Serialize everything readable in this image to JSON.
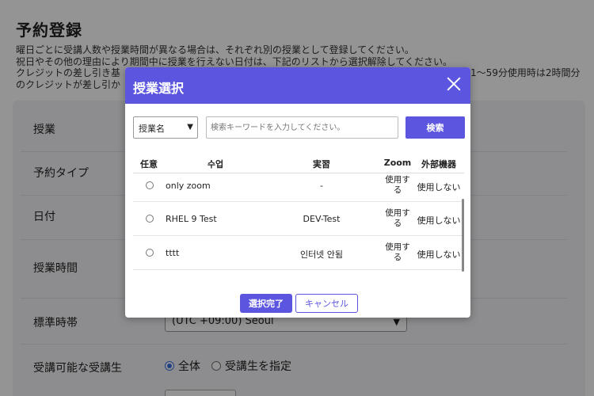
{
  "page": {
    "title": "予約登録",
    "desc_lines": [
      "曜日ごとに受講人数や授業時間が異なる場合は、それぞれ別の授業として登録してください。",
      "祝日やその他の理由により期間中に授業を行えない日付は、下記のリストから選択解除してください。",
      "クレジットの差し引き基",
      "のクレジットが差し引か"
    ],
    "desc_right": [
      "1～59分使用時は2時間分",
      ""
    ]
  },
  "form": {
    "labels": [
      "授業",
      "予約タイプ",
      "日付",
      "授業時間",
      "標準時帯",
      "受講可能な受講生"
    ],
    "timezone_value": "(UTC +09:00) Seoul",
    "radios": [
      {
        "label": "全体",
        "checked": true
      },
      {
        "label": "受講生を指定",
        "checked": false
      }
    ]
  },
  "modal": {
    "title": "授業選択",
    "search_select_value": "授業名",
    "search_placeholder": "検索キーワードを入力してください。",
    "search_button": "検索",
    "columns": [
      "任意",
      "수업",
      "実習",
      "Zoom",
      "外部機器"
    ],
    "rows": [
      {
        "name": "only zoom",
        "lab": "-",
        "zoom": "使用する",
        "device": "使用しない"
      },
      {
        "name": "RHEL 9 Test",
        "lab": "DEV-Test",
        "zoom": "使用する",
        "device": "使用しない"
      },
      {
        "name": "tttt",
        "lab": "인터넷 안됨",
        "zoom": "使用する",
        "device": "使用しない"
      }
    ],
    "done_button": "選択完了",
    "cancel_button": "キャンセル"
  }
}
